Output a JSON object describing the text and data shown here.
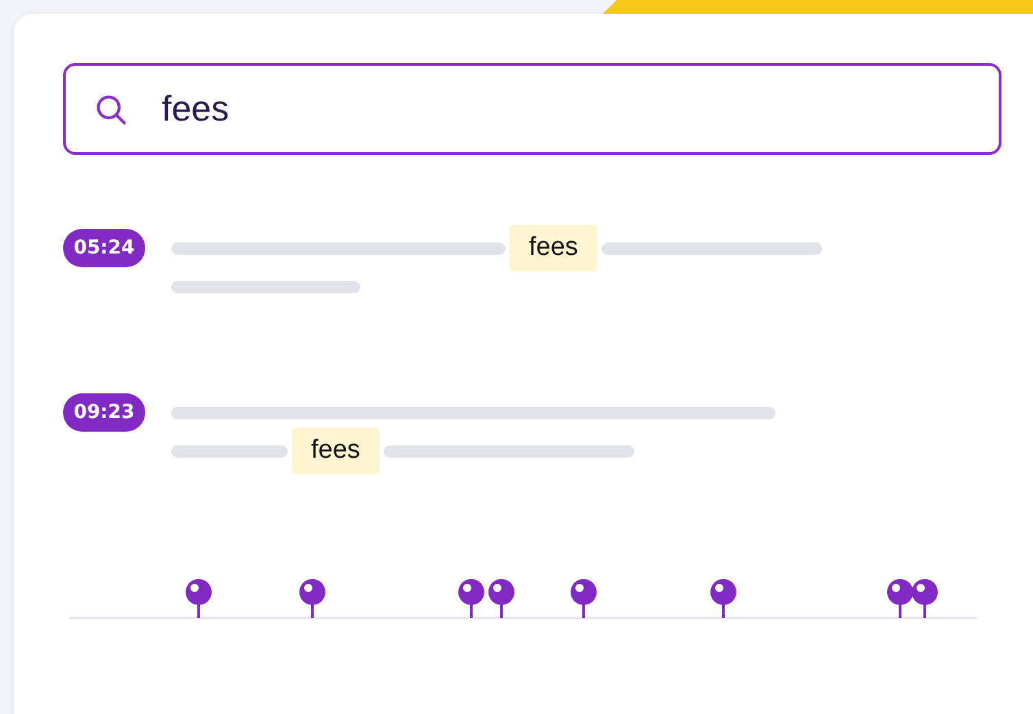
{
  "search": {
    "value": "fees"
  },
  "results": [
    {
      "time": "05:24",
      "lines": [
        [
          {
            "kind": "bar"
          },
          {
            "kind": "match",
            "text": "fees"
          },
          {
            "kind": "bar"
          }
        ],
        [
          {
            "kind": "bar"
          }
        ]
      ]
    },
    {
      "time": "09:23",
      "lines": [
        [
          {
            "kind": "bar"
          }
        ],
        [
          {
            "kind": "bar"
          },
          {
            "kind": "match",
            "text": "fees"
          },
          {
            "kind": "bar"
          }
        ]
      ]
    }
  ]
}
